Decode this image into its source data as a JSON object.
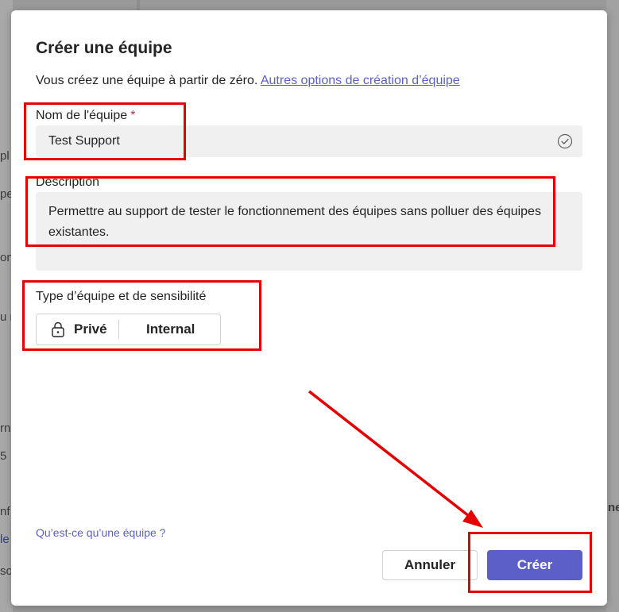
{
  "background": {
    "left_fragments": [
      "pl",
      "pe",
      "on",
      "u n",
      "rn",
      "5",
      "nf",
      "le",
      "so"
    ],
    "right_fragments": [
      "ne"
    ]
  },
  "dialog": {
    "title": "Créer une équipe",
    "subtitle_text": "Vous créez une équipe à partir de zéro.",
    "subtitle_link": "Autres options de création d’équipe",
    "name": {
      "label": "Nom de l'équipe",
      "required_marker": "*",
      "value": "Test Support",
      "status_icon": "check-circle-icon"
    },
    "description": {
      "label": "Description",
      "value": "Permettre au support de tester le fonctionnement des équipes sans polluer des équipes existantes."
    },
    "team_type": {
      "label": "Type d’équipe et de sensibilité",
      "privacy_icon": "lock-icon",
      "privacy": "Privé",
      "sensitivity": "Internal"
    },
    "help_link": "Qu’est-ce qu’une équipe ?",
    "buttons": {
      "cancel": "Annuler",
      "create": "Créer"
    }
  },
  "colors": {
    "accent": "#5b5fc7",
    "annotation": "#e60000",
    "required": "#c4314b",
    "field_bg": "#f0f0f0"
  }
}
